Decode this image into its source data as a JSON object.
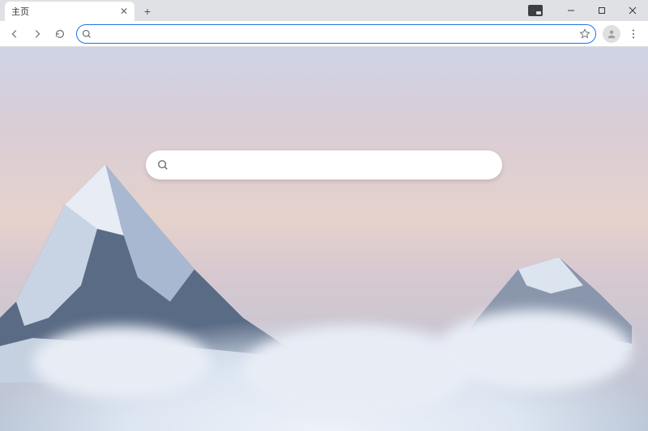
{
  "tab": {
    "title": "主页"
  },
  "omnibox": {
    "value": "",
    "placeholder": ""
  },
  "center_search": {
    "value": "",
    "placeholder": ""
  }
}
